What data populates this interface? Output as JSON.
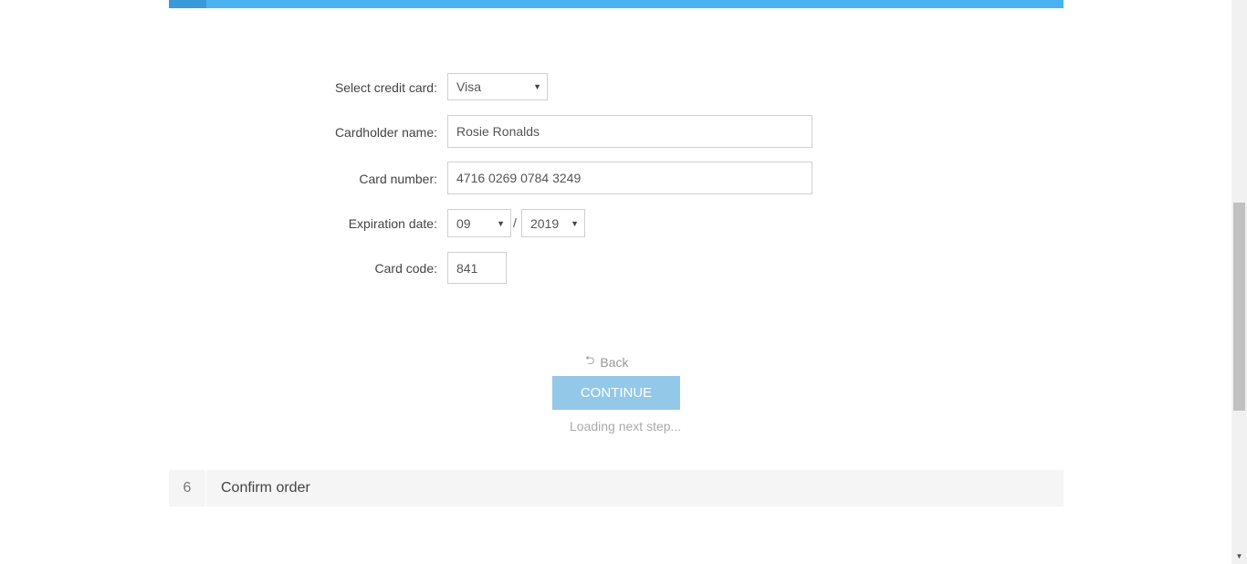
{
  "form": {
    "credit_card_label": "Select credit card:",
    "credit_card_value": "Visa",
    "cardholder_label": "Cardholder name:",
    "cardholder_value": "Rosie Ronalds",
    "card_number_label": "Card number:",
    "card_number_value": "4716 0269 0784 3249",
    "expiration_label": "Expiration date:",
    "expiration_month": "09",
    "expiration_separator": "/",
    "expiration_year": "2019",
    "card_code_label": "Card code:",
    "card_code_value": "841"
  },
  "actions": {
    "back_label": "Back",
    "back_icon": "return-arrow-icon",
    "continue_label": "CONTINUE",
    "loading_text": "Loading next step..."
  },
  "next_step": {
    "number": "6",
    "title": "Confirm order"
  },
  "colors": {
    "accent": "#4ab2f1",
    "continue_button": "#93c8e8"
  }
}
